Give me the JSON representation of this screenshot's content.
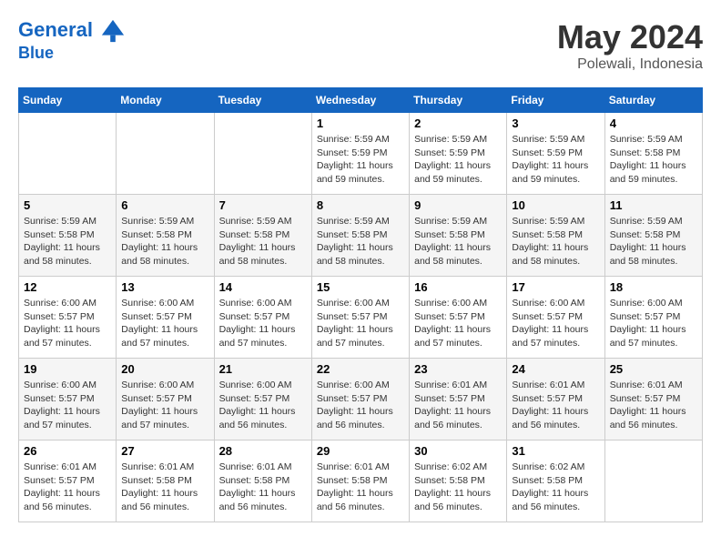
{
  "header": {
    "logo_line1": "General",
    "logo_line2": "Blue",
    "month_year": "May 2024",
    "location": "Polewali, Indonesia"
  },
  "weekdays": [
    "Sunday",
    "Monday",
    "Tuesday",
    "Wednesday",
    "Thursday",
    "Friday",
    "Saturday"
  ],
  "weeks": [
    [
      {
        "day": "",
        "info": ""
      },
      {
        "day": "",
        "info": ""
      },
      {
        "day": "",
        "info": ""
      },
      {
        "day": "1",
        "sunrise": "5:59 AM",
        "sunset": "5:59 PM",
        "daylight": "11 hours and 59 minutes."
      },
      {
        "day": "2",
        "sunrise": "5:59 AM",
        "sunset": "5:59 PM",
        "daylight": "11 hours and 59 minutes."
      },
      {
        "day": "3",
        "sunrise": "5:59 AM",
        "sunset": "5:59 PM",
        "daylight": "11 hours and 59 minutes."
      },
      {
        "day": "4",
        "sunrise": "5:59 AM",
        "sunset": "5:58 PM",
        "daylight": "11 hours and 59 minutes."
      }
    ],
    [
      {
        "day": "5",
        "sunrise": "5:59 AM",
        "sunset": "5:58 PM",
        "daylight": "11 hours and 58 minutes."
      },
      {
        "day": "6",
        "sunrise": "5:59 AM",
        "sunset": "5:58 PM",
        "daylight": "11 hours and 58 minutes."
      },
      {
        "day": "7",
        "sunrise": "5:59 AM",
        "sunset": "5:58 PM",
        "daylight": "11 hours and 58 minutes."
      },
      {
        "day": "8",
        "sunrise": "5:59 AM",
        "sunset": "5:58 PM",
        "daylight": "11 hours and 58 minutes."
      },
      {
        "day": "9",
        "sunrise": "5:59 AM",
        "sunset": "5:58 PM",
        "daylight": "11 hours and 58 minutes."
      },
      {
        "day": "10",
        "sunrise": "5:59 AM",
        "sunset": "5:58 PM",
        "daylight": "11 hours and 58 minutes."
      },
      {
        "day": "11",
        "sunrise": "5:59 AM",
        "sunset": "5:58 PM",
        "daylight": "11 hours and 58 minutes."
      }
    ],
    [
      {
        "day": "12",
        "sunrise": "6:00 AM",
        "sunset": "5:57 PM",
        "daylight": "11 hours and 57 minutes."
      },
      {
        "day": "13",
        "sunrise": "6:00 AM",
        "sunset": "5:57 PM",
        "daylight": "11 hours and 57 minutes."
      },
      {
        "day": "14",
        "sunrise": "6:00 AM",
        "sunset": "5:57 PM",
        "daylight": "11 hours and 57 minutes."
      },
      {
        "day": "15",
        "sunrise": "6:00 AM",
        "sunset": "5:57 PM",
        "daylight": "11 hours and 57 minutes."
      },
      {
        "day": "16",
        "sunrise": "6:00 AM",
        "sunset": "5:57 PM",
        "daylight": "11 hours and 57 minutes."
      },
      {
        "day": "17",
        "sunrise": "6:00 AM",
        "sunset": "5:57 PM",
        "daylight": "11 hours and 57 minutes."
      },
      {
        "day": "18",
        "sunrise": "6:00 AM",
        "sunset": "5:57 PM",
        "daylight": "11 hours and 57 minutes."
      }
    ],
    [
      {
        "day": "19",
        "sunrise": "6:00 AM",
        "sunset": "5:57 PM",
        "daylight": "11 hours and 57 minutes."
      },
      {
        "day": "20",
        "sunrise": "6:00 AM",
        "sunset": "5:57 PM",
        "daylight": "11 hours and 57 minutes."
      },
      {
        "day": "21",
        "sunrise": "6:00 AM",
        "sunset": "5:57 PM",
        "daylight": "11 hours and 56 minutes."
      },
      {
        "day": "22",
        "sunrise": "6:00 AM",
        "sunset": "5:57 PM",
        "daylight": "11 hours and 56 minutes."
      },
      {
        "day": "23",
        "sunrise": "6:01 AM",
        "sunset": "5:57 PM",
        "daylight": "11 hours and 56 minutes."
      },
      {
        "day": "24",
        "sunrise": "6:01 AM",
        "sunset": "5:57 PM",
        "daylight": "11 hours and 56 minutes."
      },
      {
        "day": "25",
        "sunrise": "6:01 AM",
        "sunset": "5:57 PM",
        "daylight": "11 hours and 56 minutes."
      }
    ],
    [
      {
        "day": "26",
        "sunrise": "6:01 AM",
        "sunset": "5:57 PM",
        "daylight": "11 hours and 56 minutes."
      },
      {
        "day": "27",
        "sunrise": "6:01 AM",
        "sunset": "5:58 PM",
        "daylight": "11 hours and 56 minutes."
      },
      {
        "day": "28",
        "sunrise": "6:01 AM",
        "sunset": "5:58 PM",
        "daylight": "11 hours and 56 minutes."
      },
      {
        "day": "29",
        "sunrise": "6:01 AM",
        "sunset": "5:58 PM",
        "daylight": "11 hours and 56 minutes."
      },
      {
        "day": "30",
        "sunrise": "6:02 AM",
        "sunset": "5:58 PM",
        "daylight": "11 hours and 56 minutes."
      },
      {
        "day": "31",
        "sunrise": "6:02 AM",
        "sunset": "5:58 PM",
        "daylight": "11 hours and 56 minutes."
      },
      {
        "day": "",
        "info": ""
      }
    ]
  ],
  "labels": {
    "sunrise_prefix": "Sunrise: ",
    "sunset_prefix": "Sunset: ",
    "daylight_prefix": "Daylight: "
  }
}
